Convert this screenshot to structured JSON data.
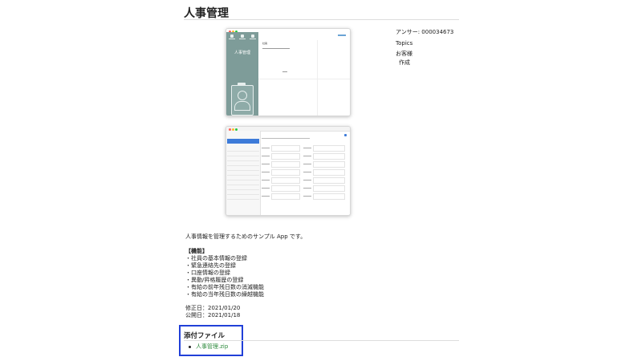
{
  "page": {
    "title": "人事管理"
  },
  "screenshot1": {
    "app_label": "人事管理",
    "content_label": "社員"
  },
  "meta": {
    "answer_id": "アンサー: 000034673",
    "topics": "Topics",
    "customer": "お客様",
    "create": "作成"
  },
  "description": {
    "intro": "人事情報を管理するためのサンプル App です。",
    "features_heading": "【機能】",
    "features": [
      "・社員の基本情報の登録",
      "・緊急連絡先の登録",
      "・口座情報の登録",
      "・異動/昇格履歴の登録",
      "・有給の前年残日数の消滅機能",
      "・有給の当年残日数の繰越機能"
    ],
    "modified": "修正日：2021/01/20",
    "published": "公開日：2021/01/18"
  },
  "attachments": {
    "heading": "添付ファイル",
    "file": "人事管理.zip"
  },
  "colors": {
    "highlight_box": "#2140d8",
    "link": "#2e8b3d",
    "sidebar_teal": "#7e9c99"
  }
}
